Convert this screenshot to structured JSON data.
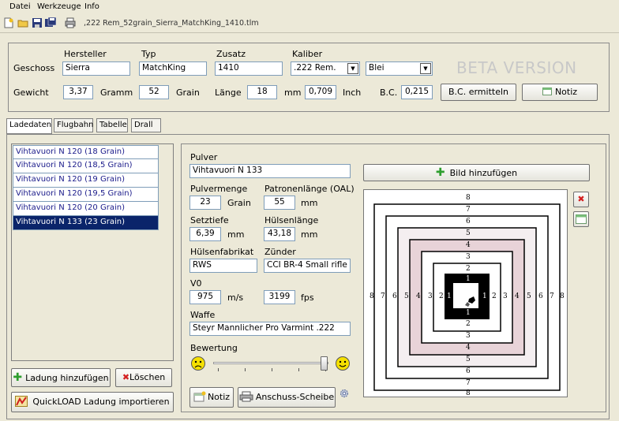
{
  "menu": [
    "Datei",
    "Werkzeuge",
    "Info"
  ],
  "toolbar": {
    "file_name": ",222 Rem_52grain_Sierra_MatchKing_1410.tlm"
  },
  "header": {
    "col_hersteller": "Hersteller",
    "col_typ": "Typ",
    "col_zusatz": "Zusatz",
    "col_kaliber": "Kaliber",
    "geschoss_label": "Geschoss",
    "hersteller": "Sierra",
    "typ": "MatchKing",
    "zusatz": "1410",
    "kaliber": ".222 Rem.",
    "material": "Blei",
    "beta": "BETA VERSION",
    "gewicht_label": "Gewicht",
    "gewicht_gramm": "3,37",
    "gramm_label": "Gramm",
    "gewicht_grain": "52",
    "grain_label": "Grain",
    "laenge_label": "Länge",
    "laenge_mm": "18",
    "mm_label": "mm",
    "laenge_inch": "0,709",
    "inch_label": "Inch",
    "bc_label": "B.C.",
    "bc_value": "0,215",
    "bc_button": "B.C. ermitteln",
    "notiz_button": "Notiz"
  },
  "tabs": [
    "Ladedaten",
    "Flugbahn",
    "Tabelle",
    "Drall"
  ],
  "loads": [
    "Vihtavuori N 120 (18 Grain)",
    "Vihtavuori N 120 (18,5 Grain)",
    "Vihtavuori N 120 (19 Grain)",
    "Vihtavuori N 120 (19,5 Grain)",
    "Vihtavuori N 120 (20 Grain)",
    "Vihtavuori N 133 (23 Grain)"
  ],
  "load_buttons": {
    "add": "Ladung hinzufügen",
    "delete": "Löschen",
    "import": "QuickLOAD Ladung importieren"
  },
  "details": {
    "pulver_label": "Pulver",
    "pulver": "Vihtavuori N 133",
    "pulvermenge_label": "Pulvermenge",
    "pulvermenge": "23",
    "grain_label": "Grain",
    "oal_label": "Patronenlänge (OAL)",
    "oal": "55",
    "mm_label": "mm",
    "setztiefe_label": "Setztiefe",
    "setztiefe": "6,39",
    "huelsenlaenge_label": "Hülsenlänge",
    "huelsenlaenge": "43,18",
    "huelsenfabrikat_label": "Hülsenfabrikat",
    "huelsenfabrikat": "RWS",
    "zuender_label": "Zünder",
    "zuender": "CCI BR-4 Small rifle",
    "v0_label": "V0",
    "v0_ms": "975",
    "ms_label": "m/s",
    "v0_fps": "3199",
    "fps_label": "fps",
    "waffe_label": "Waffe",
    "waffe": "Steyr Mannlicher Pro Varmint .222",
    "bewertung_label": "Bewertung",
    "bewertung_level": 1.0,
    "notiz_button": "Notiz",
    "scheibe_button": "Anschuss-Scheibe",
    "bild_button": "Bild hinzufügen"
  },
  "target": {
    "top_labels": [
      "8",
      "7",
      "6",
      "5",
      "4",
      "3",
      "2",
      "1"
    ],
    "bottom_labels": [
      "1",
      "2",
      "3",
      "4",
      "5",
      "6",
      "7",
      "8"
    ],
    "left_labels": [
      "8",
      "7",
      "6",
      "5",
      "4",
      "3",
      "2",
      "1"
    ],
    "right_labels": [
      "1",
      "2",
      "3",
      "4",
      "5",
      "6",
      "7",
      "8"
    ]
  },
  "colors": {
    "selection": "#0a246a",
    "ring_pink": "#e8d3d8",
    "accent_green": "#2e9e2e",
    "delete_red": "#d42020"
  }
}
